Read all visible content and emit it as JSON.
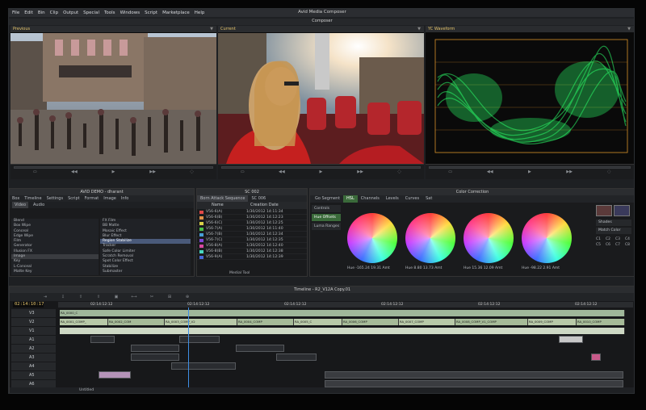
{
  "app": {
    "title": "Avid Media Composer",
    "menus": [
      "File",
      "Edit",
      "Bin",
      "Clip",
      "Output",
      "Special",
      "Tools",
      "Windows",
      "Script",
      "Marketplace",
      "Help"
    ]
  },
  "composer": {
    "title": "Composer",
    "monitors": [
      {
        "label": "Previous"
      },
      {
        "label": "Current"
      },
      {
        "label": "YC Waveform"
      }
    ]
  },
  "bin": {
    "title": "AVID DEMO - dharant",
    "tabs": [
      "Box",
      "Timeline",
      "Settings",
      "Script",
      "Format",
      "Image",
      "Info"
    ],
    "subtabs": [
      "Video",
      "Audio"
    ],
    "categories": [
      "Blend",
      "Box Wipe",
      "Conceal",
      "Edge Wipe",
      "Film",
      "Generator",
      "Illusion FX",
      "Image",
      "Key",
      "L-Conceal",
      "Matte Key"
    ],
    "effects": [
      "FX Film",
      "BB Matte",
      "Mosaic Effect",
      "Blur Effect",
      "Region Stabilize",
      "Tracker",
      "Safe Color Limiter",
      "Scratch Removal",
      "Spot Color Effect",
      "Stabilize",
      "Submaster"
    ]
  },
  "sequence": {
    "title": "SC 002",
    "tabs": [
      "Born Attack Sequence",
      "SC 006"
    ],
    "columns": {
      "name": "Name",
      "date": "Creation Date"
    },
    "rows": [
      {
        "name": "V56-6(A)",
        "date": "1/30/2012 14:11:34",
        "color": "#e04848"
      },
      {
        "name": "V56-6(B)",
        "date": "1/30/2012 14:12:23",
        "color": "#e09048"
      },
      {
        "name": "V56-6(C)",
        "date": "1/30/2012 14:12:25",
        "color": "#d8d048"
      },
      {
        "name": "V56-7(A)",
        "date": "1/30/2012 14:11:40",
        "color": "#48c048"
      },
      {
        "name": "V56-7(B)",
        "date": "1/30/2012 14:12:34",
        "color": "#48a0d8"
      },
      {
        "name": "V56-7(C)",
        "date": "1/30/2012 14:12:35",
        "color": "#8048d8"
      },
      {
        "name": "V56-8(A)",
        "date": "1/30/2012 14:12:40",
        "color": "#d848a0"
      },
      {
        "name": "V56-8(B)",
        "date": "1/30/2012 14:12:38",
        "color": "#48d8c0"
      },
      {
        "name": "V56-9(A)",
        "date": "1/30/2012 14:12:39",
        "color": "#4868d8"
      }
    ],
    "footer": "Medial Tool"
  },
  "color_correction": {
    "title": "Color Correction",
    "tabs": [
      "Go Segment",
      "HSL",
      "Channels",
      "Levels",
      "Curves",
      "Sat"
    ],
    "side": [
      "Controls",
      "Hue Offsets",
      "Luma Ranges"
    ],
    "wheels": [
      {
        "readout": "Hue -165.24  19.31  Amt"
      },
      {
        "readout": "Hue 8.80  13.73  Amt"
      },
      {
        "readout": "Hue 15.36  12.09  Amt"
      },
      {
        "readout": "Hue -98.22  2.91  Amt"
      }
    ],
    "right": [
      "Shades",
      "Match Color"
    ],
    "cells": [
      "C1",
      "C2",
      "C3",
      "C4",
      "C5",
      "C6",
      "C7",
      "C8"
    ]
  },
  "timeline": {
    "title": "Timeline - R2_V12A Copy.01",
    "timecode": "02:14:10:17",
    "ticks": [
      "02:14:12:12",
      "02:14:12:12",
      "02:14:12:12",
      "02:14:12:12",
      "02:14:12:12",
      "02:14:12:12"
    ],
    "tracks": [
      "V3",
      "V2",
      "V1",
      "A1",
      "A2",
      "A3",
      "A4",
      "A5",
      "A6"
    ],
    "video_clips": [
      "RA_0000_C",
      "RA_0001_COMP_",
      "RA_0002_COM",
      "RA_0003_COMP_V2",
      "RA_0004_COMP",
      "RA_0005_C",
      "RA_0006_COMP",
      "RA_0007_COMP",
      "RA_0008_COMP_V1_COMP",
      "RA_0009_COMP",
      "RA_0010_COMP"
    ],
    "footer": "Untitled"
  }
}
